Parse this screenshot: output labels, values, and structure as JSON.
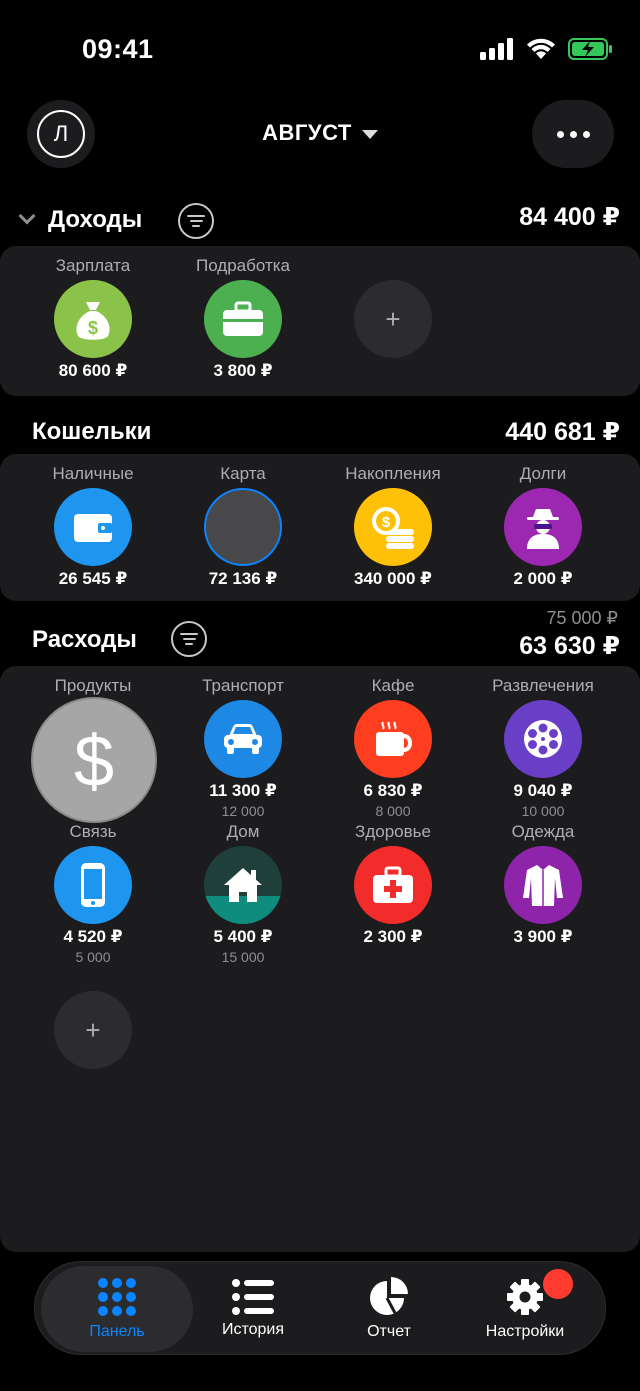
{
  "status_bar": {
    "time": "09:41"
  },
  "header": {
    "avatar_letter": "Л",
    "month": "АВГУСТ"
  },
  "income": {
    "title": "Доходы",
    "total": "84 400 ₽",
    "items": [
      {
        "label": "Зарплата",
        "amount": "80 600 ₽",
        "icon": "money-bag-icon",
        "color": "#8BC34A"
      },
      {
        "label": "Подработка",
        "amount": "3 800 ₽",
        "icon": "briefcase-icon",
        "color": "#4CAF50"
      }
    ],
    "add_label": "+"
  },
  "wallets": {
    "title": "Кошельки",
    "total": "440 681 ₽",
    "items": [
      {
        "label": "Наличные",
        "amount": "26 545 ₽",
        "icon": "wallet-icon",
        "color": "#1E96F0"
      },
      {
        "label": "Карта",
        "amount": "72 136 ₽",
        "icon": "card-placeholder-icon",
        "color": "#48484A"
      },
      {
        "label": "Накопления",
        "amount": "340 000 ₽",
        "icon": "coins-icon",
        "color": "#FFC107"
      },
      {
        "label": "Долги",
        "amount": "2 000 ₽",
        "icon": "spy-icon",
        "color": "#9C27B0"
      }
    ]
  },
  "expenses": {
    "title": "Расходы",
    "budget_total": "75 000 ₽",
    "total": "63 630 ₽",
    "items": [
      {
        "label": "Продукты",
        "amount": "",
        "budget": "",
        "icon": "dollar-drag-icon",
        "color": "#A6A6A6"
      },
      {
        "label": "Транспорт",
        "amount": "11 300 ₽",
        "budget": "12 000",
        "icon": "car-icon",
        "color": "#1E88E5"
      },
      {
        "label": "Кафе",
        "amount": "6 830 ₽",
        "budget": "8 000",
        "icon": "coffee-cup-icon",
        "color": "#FF3D1F"
      },
      {
        "label": "Развлечения",
        "amount": "9 040 ₽",
        "budget": "10 000",
        "icon": "film-reel-icon",
        "color": "#6A3FC8"
      },
      {
        "label": "Связь",
        "amount": "4 520 ₽",
        "budget": "5 000",
        "icon": "phone-icon",
        "color": "#1E96F0"
      },
      {
        "label": "Дом",
        "amount": "5 400 ₽",
        "budget": "15 000",
        "icon": "house-icon",
        "color": "#0E8C7E"
      },
      {
        "label": "Здоровье",
        "amount": "2 300 ₽",
        "budget": "",
        "icon": "first-aid-icon",
        "color": "#F22B2B"
      },
      {
        "label": "Одежда",
        "amount": "3 900 ₽",
        "budget": "",
        "icon": "shirt-icon",
        "color": "#8E24AA"
      }
    ],
    "add_label": "+",
    "dom_progress": 0.36
  },
  "tabbar": {
    "tabs": [
      {
        "label": "Панель",
        "icon": "grid-icon",
        "active": true
      },
      {
        "label": "История",
        "icon": "list-icon",
        "active": false
      },
      {
        "label": "Отчет",
        "icon": "pie-chart-icon",
        "active": false
      },
      {
        "label": "Настройки",
        "icon": "gear-icon",
        "active": false
      }
    ]
  },
  "colors": {
    "accent": "#0A84FF",
    "background": "#000000",
    "panel": "#1C1C1E",
    "badge": "#FF3B30"
  }
}
